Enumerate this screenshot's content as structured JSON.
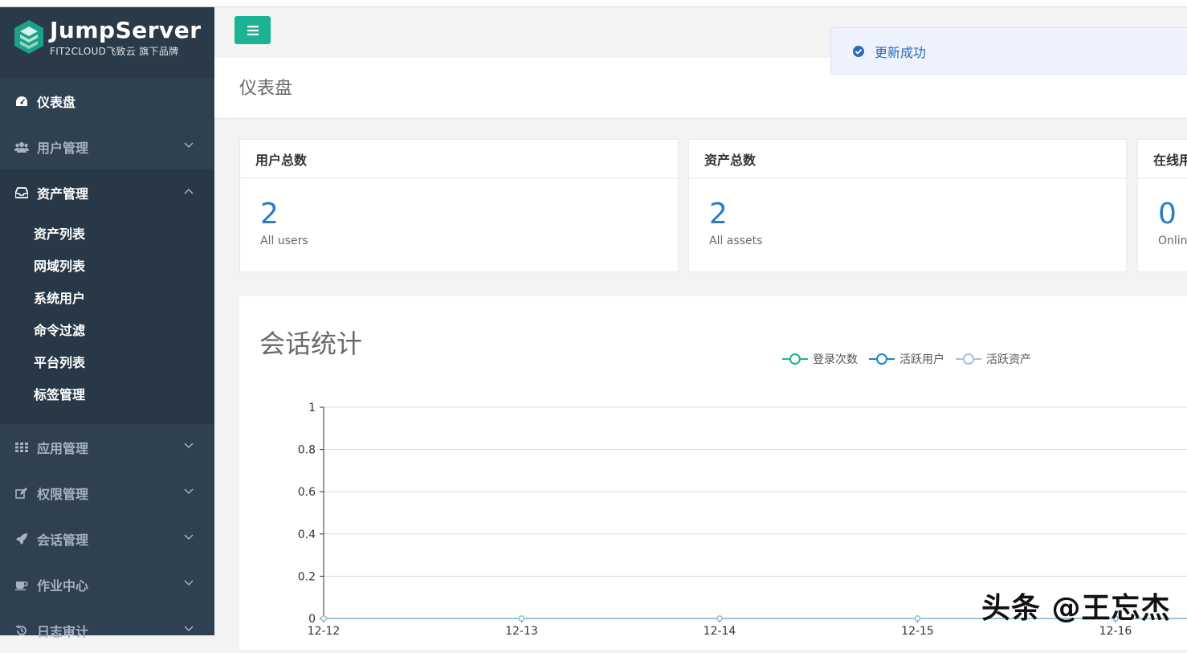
{
  "app": {
    "logo_title": "JumpServer",
    "logo_subtitle": "FIT2CLOUD飞致云 旗下品牌"
  },
  "sidebar": {
    "items": [
      {
        "label": "仪表盘",
        "icon": "dashboard-icon"
      },
      {
        "label": "用户管理",
        "icon": "users-icon"
      },
      {
        "label": "资产管理",
        "icon": "inbox-icon"
      },
      {
        "label": "应用管理",
        "icon": "grid-icon"
      },
      {
        "label": "权限管理",
        "icon": "edit-icon"
      },
      {
        "label": "会话管理",
        "icon": "rocket-icon"
      },
      {
        "label": "作业中心",
        "icon": "coffee-icon"
      },
      {
        "label": "日志审计",
        "icon": "history-icon"
      }
    ],
    "asset_submenu": [
      "资产列表",
      "网域列表",
      "系统用户",
      "命令过滤",
      "平台列表",
      "标签管理"
    ]
  },
  "toast": {
    "text": "更新成功"
  },
  "page": {
    "title": "仪表盘"
  },
  "cards": [
    {
      "title": "用户总数",
      "value": "2",
      "caption": "All users"
    },
    {
      "title": "资产总数",
      "value": "2",
      "caption": "All assets"
    },
    {
      "title": "在线用",
      "value": "0",
      "caption": "Onlin"
    }
  ],
  "chart_data": {
    "type": "line",
    "title": "会话统计",
    "categories": [
      "12-12",
      "12-13",
      "12-14",
      "12-15",
      "12-16"
    ],
    "series": [
      {
        "name": "登录次数",
        "values": [
          0,
          0,
          0,
          0,
          0
        ],
        "color": "#1ab394"
      },
      {
        "name": "活跃用户",
        "values": [
          0,
          0,
          0,
          0,
          0
        ],
        "color": "#1c84c6"
      },
      {
        "name": "活跃资产",
        "values": [
          0,
          0,
          0,
          0,
          0
        ],
        "color": "#9cc3da"
      }
    ],
    "y_ticks": [
      "0",
      "0.2",
      "0.4",
      "0.6",
      "0.8",
      "1"
    ],
    "ylim": [
      0,
      1
    ],
    "grid": true,
    "legend_position": "top"
  },
  "watermark": "头条 @王忘杰",
  "colors": {
    "sidebar_bg": "#2f4050",
    "primary": "#1ab394",
    "number_blue": "#2b7cc2"
  }
}
